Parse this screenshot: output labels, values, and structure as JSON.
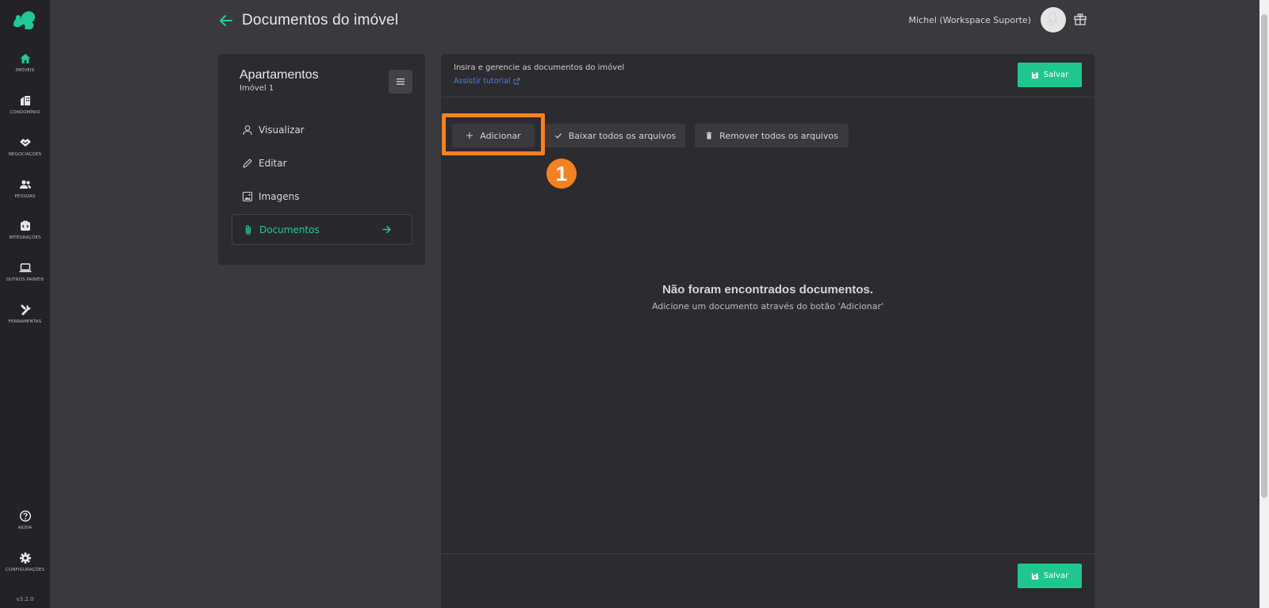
{
  "nav": {
    "items": [
      {
        "label": "IMÓVEIS",
        "icon": "home-icon"
      },
      {
        "label": "CONDOMÍNIO",
        "icon": "building-icon"
      },
      {
        "label": "NEGOCIAÇÕES",
        "icon": "handshake-icon"
      },
      {
        "label": "PESSOAS",
        "icon": "users-icon"
      },
      {
        "label": "INTEGRAÇÕES",
        "icon": "integration-icon"
      },
      {
        "label": "OUTROS PAINÉIS",
        "icon": "laptop-icon"
      },
      {
        "label": "FERRAMENTAS",
        "icon": "tools-icon"
      }
    ],
    "bottom": [
      {
        "label": "AJUDA",
        "icon": "help-icon"
      },
      {
        "label": "CONFIGURAÇÕES",
        "icon": "gear-icon"
      }
    ],
    "version": "v3.2.0"
  },
  "header": {
    "title": "Documentos do imóvel",
    "user": "Michel (Workspace Suporte)",
    "avatar_text": "- -"
  },
  "sidebar": {
    "title": "Apartamentos",
    "subtitle": "Imóvel 1",
    "items": [
      {
        "label": "Visualizar",
        "icon": "user-icon"
      },
      {
        "label": "Editar",
        "icon": "pencil-icon"
      },
      {
        "label": "Imagens",
        "icon": "image-icon"
      },
      {
        "label": "Documentos",
        "icon": "paperclip-icon"
      }
    ]
  },
  "main": {
    "description": "Insira e gerencie as documentos do imóvel",
    "tutorial": "Assistir tutorial",
    "save_label": "Salvar",
    "add_label": "Adicionar",
    "download_all_label": "Baixar todos os arquivos",
    "remove_all_label": "Remover todos os arquivos",
    "step_number": "1",
    "empty_title": "Não foram encontrados documentos.",
    "empty_subtitle": "Adicione um documento através do botão 'Adicionar'"
  },
  "colors": {
    "accent": "#1fc78f",
    "highlight": "#f58220",
    "background": "#3a393e",
    "panel": "#2c2b2f",
    "nav": "#232226"
  }
}
